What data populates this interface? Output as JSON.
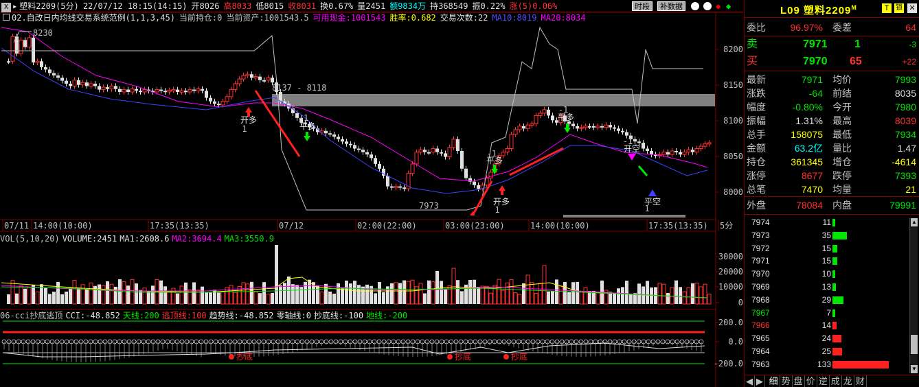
{
  "title_bar": {
    "symbol": "塑料2209(5分)",
    "datetime": "22/07/12 18:15(14:15)",
    "open": "开8026",
    "high": "高8033",
    "low": "低8015",
    "close": "收8031",
    "turnover": "换0.67%",
    "volume": "量2451",
    "amount": "额9834万",
    "hold": "持368549",
    "amplitude": "振0.22%",
    "change": "涨(5)0.06%",
    "btn_time": "时段",
    "btn_fill": "补数据"
  },
  "info_bar": {
    "strategy": "02.自改日内均线交易系统范例(1,1,3,45)",
    "position": "当前持仓:0",
    "assets": "当前资产:1001543.5",
    "cash": "可用现金:1001543",
    "winrate": "胜率:0.682",
    "trades": "交易次数:22",
    "ma10": "MA10:8019",
    "ma20": "MA20:8034"
  },
  "price_axis": [
    "8200",
    "8150",
    "8100",
    "8050",
    "8000"
  ],
  "annotations": {
    "high_label": "8230",
    "range_label": "8137 - 8118",
    "low_label": "7973",
    "signals": [
      "开多",
      "1",
      "-1",
      "平多",
      "-1",
      "平多",
      "开多",
      "1",
      "-1",
      "平多",
      "-1",
      "开空",
      "平空",
      "1"
    ]
  },
  "time_axis": [
    "07/11",
    "14:00(10:00)",
    "17:35(13:35)",
    "07/12",
    "02:00(22:00)",
    "03:00(23:00)",
    "14:00(10:00)",
    "17:35(13:35)",
    "5分"
  ],
  "vol_bar": {
    "label": "VOL(5,10,20)",
    "volume": "VOLUME:2451",
    "ma1": "MA1:2608.6",
    "ma2": "MA2:3694.4",
    "ma3": "MA3:3550.9"
  },
  "vol_axis": [
    "30000",
    "20000",
    "10000",
    "0"
  ],
  "cci_bar": {
    "label": "06-cci抄底逃顶",
    "cci": "CCI:-48.852",
    "sky": "天线:200",
    "top": "逃顶线:100",
    "trend": "趋势线:-48.852",
    "zero": "零轴线:0",
    "bottom": "抄底线:-100",
    "ground": "地线:-200"
  },
  "cci_axis": [
    "200.0",
    "0.0",
    "-200.0"
  ],
  "cci_marks": [
    "抄底",
    "抄底",
    "抄底"
  ],
  "right_panel": {
    "code": "L09",
    "name": "塑料2209",
    "badge_m": "M",
    "badge_t": "T",
    "badge_lock": "锁",
    "wei_bi_label": "委比",
    "wei_bi": "96.97%",
    "wei_cha_label": "委差",
    "wei_cha": "64",
    "sell_label": "卖",
    "sell_price": "7971",
    "sell_qty": "1",
    "sell_change": "-3",
    "buy_label": "买",
    "buy_price": "7970",
    "buy_qty": "65",
    "buy_change": "+22",
    "stats": [
      {
        "l1": "最新",
        "v1": "7971",
        "c1": "green",
        "l2": "均价",
        "v2": "7993",
        "c2": "green"
      },
      {
        "l1": "涨跌",
        "v1": "-64",
        "c1": "green",
        "l2": "前结",
        "v2": "8035",
        "c2": "white"
      },
      {
        "l1": "幅度",
        "v1": "-0.80%",
        "c1": "green",
        "l2": "今开",
        "v2": "7980",
        "c2": "green"
      },
      {
        "l1": "振幅",
        "v1": "1.31%",
        "c1": "white",
        "l2": "最高",
        "v2": "8039",
        "c2": "red"
      },
      {
        "l1": "总手",
        "v1": "158075",
        "c1": "yellow",
        "l2": "最低",
        "v2": "7934",
        "c2": "green"
      },
      {
        "l1": "金额",
        "v1": "63.2亿",
        "c1": "cyan",
        "l2": "量比",
        "v2": "1.47",
        "c2": "white"
      },
      {
        "l1": "持仓",
        "v1": "361345",
        "c1": "yellow",
        "l2": "增仓",
        "v2": "-4614",
        "c2": "yellow"
      },
      {
        "l1": "涨停",
        "v1": "8677",
        "c1": "red",
        "l2": "跌停",
        "v2": "7393",
        "c2": "green"
      },
      {
        "l1": "总笔",
        "v1": "7470",
        "c1": "yellow",
        "l2": "均量",
        "v2": "21",
        "c2": "yellow"
      }
    ],
    "outer_label": "外盘",
    "outer": "78084",
    "inner_label": "内盘",
    "inner": "79991",
    "ticks": [
      {
        "p": "7974",
        "q": "11",
        "pc": "white",
        "bc": "#00e600",
        "w": 0.04
      },
      {
        "p": "7973",
        "q": "35",
        "pc": "white",
        "bc": "#00e600",
        "w": 0.26
      },
      {
        "p": "7972",
        "q": "15",
        "pc": "white",
        "bc": "#00e600",
        "w": 0.08
      },
      {
        "p": "7971",
        "q": "15",
        "pc": "white",
        "bc": "#00e600",
        "w": 0.08
      },
      {
        "p": "7970",
        "q": "10",
        "pc": "white",
        "bc": "#00e600",
        "w": 0.04
      },
      {
        "p": "7969",
        "q": "13",
        "pc": "white",
        "bc": "#00e600",
        "w": 0.06
      },
      {
        "p": "7968",
        "q": "29",
        "pc": "white",
        "bc": "#00e600",
        "w": 0.2
      },
      {
        "p": "7967",
        "q": "7",
        "pc": "green",
        "bc": "#00e600",
        "w": 0.03
      },
      {
        "p": "7966",
        "q": "14",
        "pc": "red",
        "bc": "#ff2020",
        "w": 0.07
      },
      {
        "p": "7965",
        "q": "24",
        "pc": "white",
        "bc": "#ff2020",
        "w": 0.16
      },
      {
        "p": "7964",
        "q": "25",
        "pc": "white",
        "bc": "#ff2020",
        "w": 0.17
      },
      {
        "p": "7963",
        "q": "133",
        "pc": "white",
        "bc": "#ff2020",
        "w": 1.0
      }
    ],
    "tabs": [
      "细",
      "势",
      "盘",
      "价",
      "逆",
      "成",
      "龙",
      "财"
    ]
  }
}
